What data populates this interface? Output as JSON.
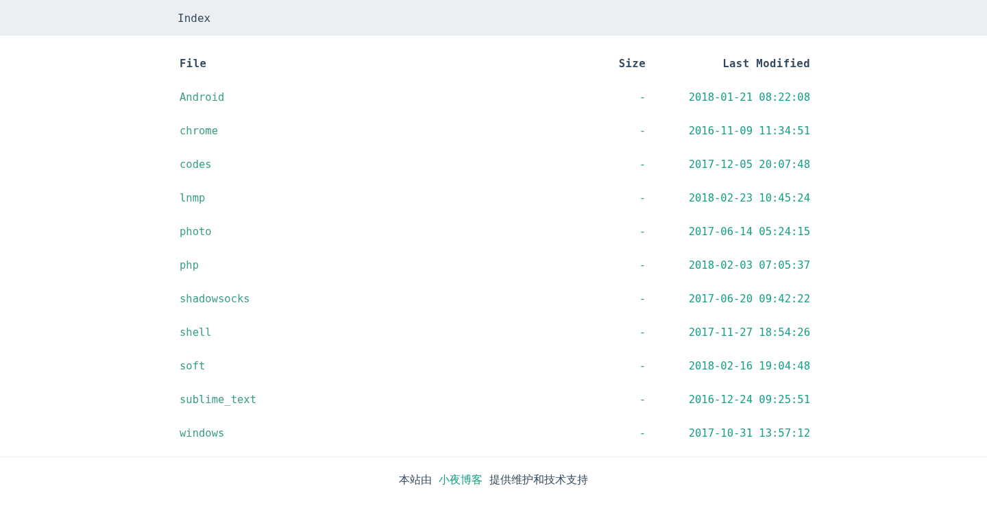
{
  "header": {
    "title": "Index"
  },
  "table": {
    "columns": [
      "File",
      "Size",
      "Last Modified"
    ],
    "rows": [
      {
        "file": "Android",
        "size": "-",
        "modified": "2018-01-21 08:22:08"
      },
      {
        "file": "chrome",
        "size": "-",
        "modified": "2016-11-09 11:34:51"
      },
      {
        "file": "codes",
        "size": "-",
        "modified": "2017-12-05 20:07:48"
      },
      {
        "file": "lnmp",
        "size": "-",
        "modified": "2018-02-23 10:45:24"
      },
      {
        "file": "photo",
        "size": "-",
        "modified": "2017-06-14 05:24:15"
      },
      {
        "file": "php",
        "size": "-",
        "modified": "2018-02-03 07:05:37"
      },
      {
        "file": "shadowsocks",
        "size": "-",
        "modified": "2017-06-20 09:42:22"
      },
      {
        "file": "shell",
        "size": "-",
        "modified": "2017-11-27 18:54:26"
      },
      {
        "file": "soft",
        "size": "-",
        "modified": "2018-02-16 19:04:48"
      },
      {
        "file": "sublime_text",
        "size": "-",
        "modified": "2016-12-24 09:25:51"
      },
      {
        "file": "windows",
        "size": "-",
        "modified": "2017-10-31 13:57:12"
      }
    ]
  },
  "footer": {
    "before": "本站由",
    "link": "小夜博客",
    "after": "提供维护和技术支持"
  }
}
